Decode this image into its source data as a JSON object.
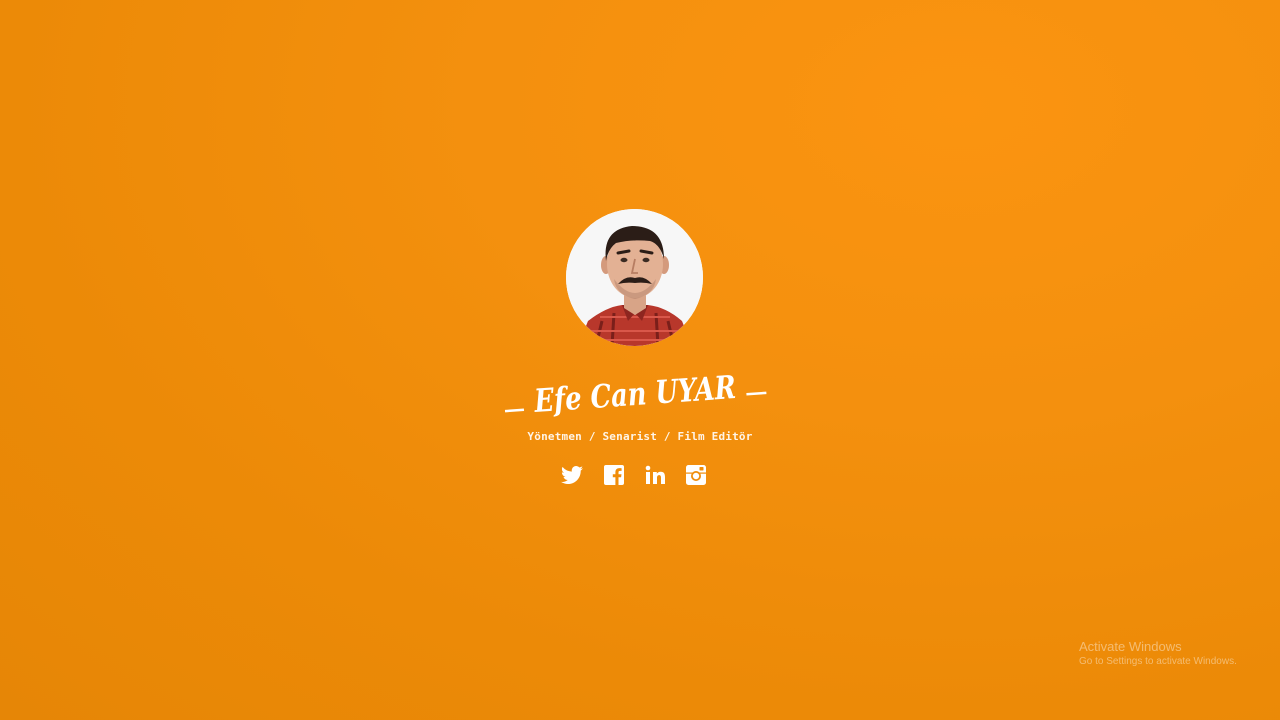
{
  "profile": {
    "name": "Efe Can UYAR",
    "subtitle": "Yönetmen / Senarist / Film Editör",
    "socials": [
      {
        "network": "Twitter",
        "icon": "twitter-icon"
      },
      {
        "network": "Facebook",
        "icon": "facebook-icon"
      },
      {
        "network": "LinkedIn",
        "icon": "linkedin-icon"
      },
      {
        "network": "Instagram",
        "icon": "instagram-icon"
      }
    ]
  },
  "watermark": {
    "title": "Activate Windows",
    "message": "Go to Settings to activate Windows."
  },
  "colors": {
    "background": "#f08d0a",
    "text": "#ffffff"
  }
}
